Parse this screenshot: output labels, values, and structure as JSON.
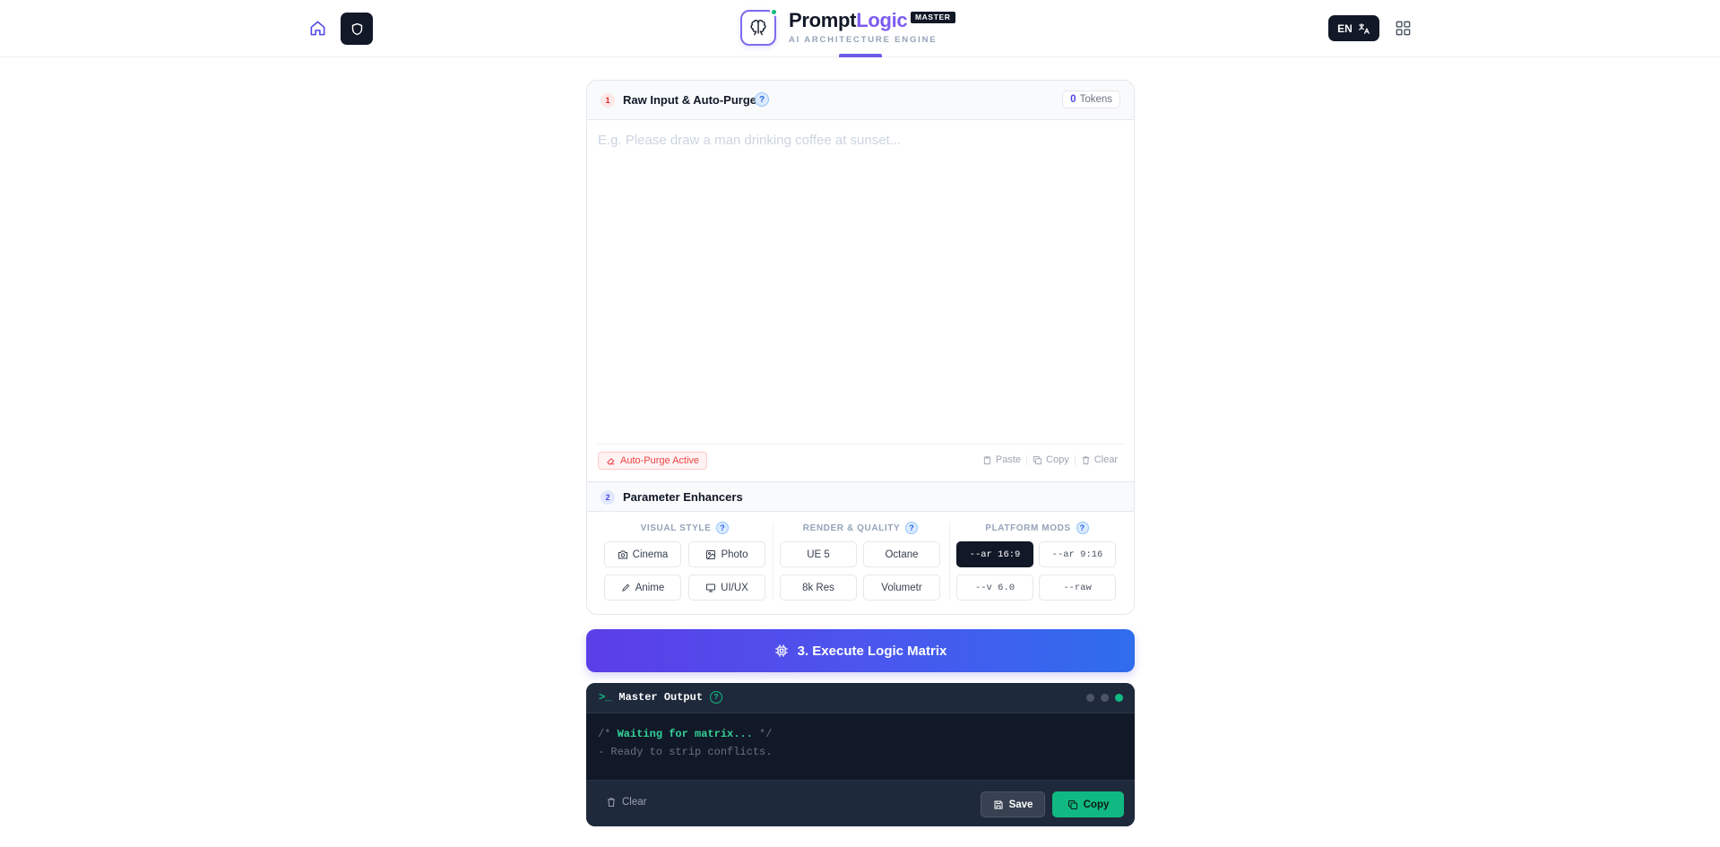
{
  "header": {
    "brand_part1": "Prompt",
    "brand_part2": "Logic",
    "badge": "MASTER",
    "tagline": "AI ARCHITECTURE ENGINE",
    "language": "EN"
  },
  "input_section": {
    "step": "1",
    "title": "Raw Input & Auto-Purge",
    "help": "?",
    "token_count": "0",
    "token_label": "Tokens",
    "placeholder": "E.g. Please draw a man drinking coffee at sunset...",
    "value": "",
    "auto_purge": "Auto-Purge Active",
    "tools": {
      "paste": "Paste",
      "copy": "Copy",
      "clear": "Clear"
    }
  },
  "params_section": {
    "step": "2",
    "title": "Parameter Enhancers",
    "visual_style": {
      "title": "VISUAL STYLE",
      "options": [
        "Cinema",
        "Photo",
        "Anime",
        "UI/UX"
      ]
    },
    "render_quality": {
      "title": "RENDER & QUALITY",
      "options": [
        "UE 5",
        "Octane",
        "8k Res",
        "Volumetr"
      ]
    },
    "platform_mods": {
      "title": "PLATFORM MODS",
      "options": [
        "--ar 16:9",
        "--ar 9:16",
        "--v 6.0",
        "--raw"
      ],
      "selected": "--ar 16:9"
    }
  },
  "execute": {
    "label": "3. Execute Logic Matrix"
  },
  "terminal": {
    "title": "Master Output",
    "prompt_symbol": ">_",
    "line1_open": "/* ",
    "line1_wait": "Waiting for matrix...",
    "line1_close": " */",
    "line2": "- Ready to strip conflicts.",
    "clear": "Clear",
    "save": "Save",
    "copy": "Copy"
  },
  "colors": {
    "accent": "#4f46e5",
    "brand": "#7c5cf0",
    "success": "#10b981",
    "danger": "#ef4444",
    "dark": "#111827"
  }
}
